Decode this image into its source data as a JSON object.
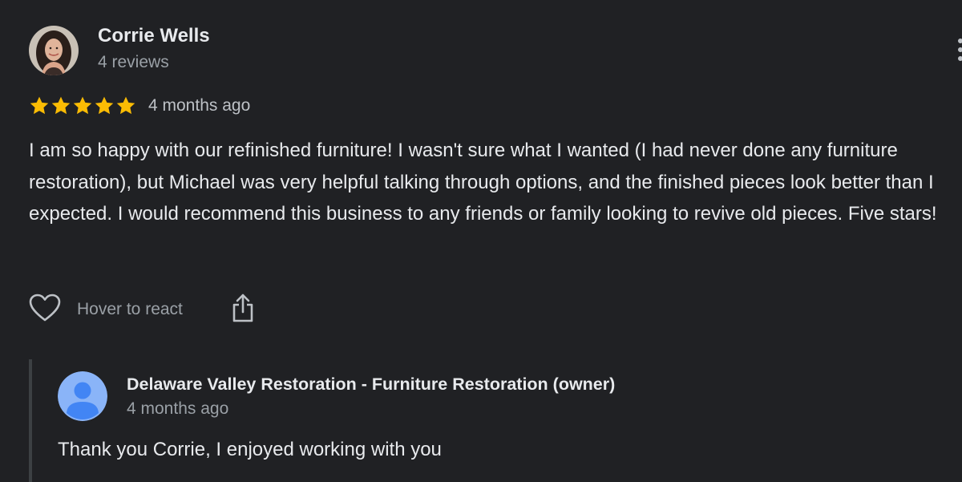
{
  "review": {
    "reviewer": {
      "name": "Corrie Wells",
      "review_count": "4 reviews"
    },
    "rating": 5,
    "max_rating": 5,
    "date": "4 months ago",
    "text": "I am so happy with our refinished furniture! I wasn't sure what I wanted (I had never done any furniture restoration), but Michael was very helpful talking through options, and the finished pieces look better than I expected. I would recommend this business to any friends or family looking to revive old pieces. Five stars!",
    "actions": {
      "react_label": "Hover to react",
      "react_icon": "heart-outline-icon",
      "share_icon": "share-icon",
      "more_icon": "more-vertical-icon"
    }
  },
  "reply": {
    "owner_name": "Delaware Valley Restoration - Furniture Restoration (owner)",
    "date": "4 months ago",
    "text": "Thank you Corrie, I enjoyed working with you"
  },
  "colors": {
    "background": "#202124",
    "star": "#fbbc04",
    "primary_text": "#e8eaed",
    "secondary_text": "#9aa0a6",
    "owner_avatar": "#4285f4"
  }
}
